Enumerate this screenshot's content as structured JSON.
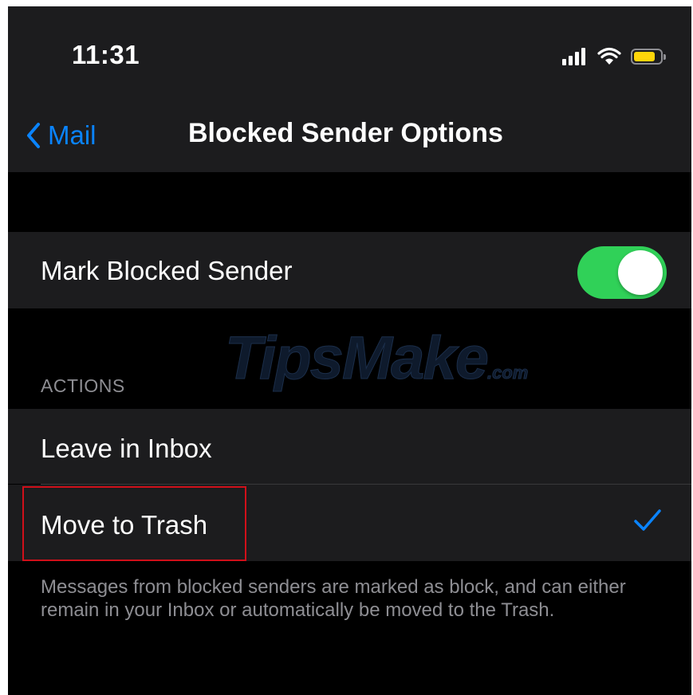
{
  "status_bar": {
    "time": "11:31",
    "signal_icon": "cellular-signal-icon",
    "wifi_icon": "wifi-icon",
    "battery_icon": "battery-icon",
    "battery_color": "#ffd60a",
    "battery_level": 0.8
  },
  "nav": {
    "back_label": "Mail",
    "back_icon": "chevron-left-icon",
    "title": "Blocked Sender Options",
    "accent_color": "#0a84ff"
  },
  "mark_blocked": {
    "label": "Mark Blocked Sender",
    "toggle_on": true,
    "toggle_color": "#30d158"
  },
  "actions": {
    "header": "ACTIONS",
    "options": [
      {
        "label": "Leave in Inbox",
        "selected": false
      },
      {
        "label": "Move to Trash",
        "selected": true,
        "check_icon": "checkmark-icon"
      }
    ]
  },
  "footer": {
    "text": "Messages from blocked senders are marked as block, and can either remain in your Inbox or automatically be moved to the Trash."
  },
  "watermark": {
    "main": "TipsMake",
    "suffix": ".com"
  }
}
